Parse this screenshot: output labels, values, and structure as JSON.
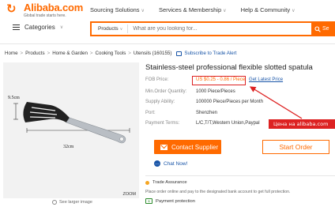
{
  "header": {
    "logo_word": "Alibaba.com",
    "logo_tagline": "Global trade starts here.",
    "nav": [
      {
        "label": "Sourcing Solutions"
      },
      {
        "label": "Services & Membership"
      },
      {
        "label": "Help & Community"
      }
    ],
    "categories_label": "Categories",
    "search": {
      "category": "Products",
      "placeholder": "What are you looking for...",
      "button_label": "Se"
    }
  },
  "breadcrumb": {
    "items": [
      "Home",
      "Products",
      "Home & Garden",
      "Cooking Tools",
      "Utensils (160155)"
    ],
    "subscribe_label": "Subscribe to Trade Alert"
  },
  "gallery": {
    "zoom_label": "ZOOM",
    "see_larger_label": "See larger image",
    "dim_width": "9.5cm",
    "dim_length": "32cm"
  },
  "product": {
    "title": "Stainless-steel professional flexible slotted spatula",
    "specs": [
      {
        "label": "FOB Price:",
        "value": "US $0.25 - 0.86 / Piece",
        "link": "Get Latest Price"
      },
      {
        "label": "Min.Order Quantity:",
        "value": "1000 Piece/Pieces"
      },
      {
        "label": "Supply Ability:",
        "value": "100000 Piece/Pieces per Month"
      },
      {
        "label": "Port:",
        "value": "Shenzhen"
      },
      {
        "label": "Payment Terms:",
        "value": "L/C,T/T,Western Union,Paypal"
      }
    ]
  },
  "annotation": {
    "callout_text": "Цена на alibaba.com"
  },
  "actions": {
    "contact_label": "Contact Supplier",
    "order_label": "Start Order",
    "chat_label": "Chat Now!"
  },
  "assurance": {
    "trade_assurance_label": "Trade Assurance",
    "trade_assurance_desc": "Place order online and pay to the designated bank account to get full protection.",
    "payment_protection_label": "Payment protection"
  },
  "colors": {
    "brand": "#ff6a00",
    "link": "#1a56a8",
    "annotation_red": "#dd2222"
  }
}
